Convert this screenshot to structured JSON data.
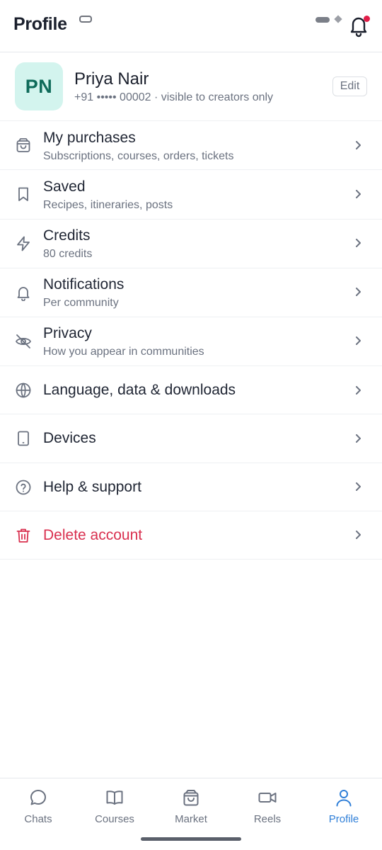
{
  "header": {
    "title": "Profile",
    "notifications_icon": "bell-icon",
    "has_unread": true,
    "unread_color": "#e11d48"
  },
  "profile": {
    "initials": "PN",
    "name": "Priya Nair",
    "phone_note": "+91 ••••• 00002 · visible to creators only",
    "edit_label": "Edit",
    "avatar_color": "#d3f4ee"
  },
  "menu": [
    {
      "title": "My purchases",
      "subtitle": "Subscriptions, courses, orders, tickets",
      "icon": "shopping-bag-icon"
    },
    {
      "title": "Saved",
      "subtitle": "Recipes, itineraries, posts",
      "icon": "bookmark-icon"
    },
    {
      "title": "Credits",
      "subtitle": "80 credits",
      "icon": "lightning-icon"
    },
    {
      "title": "Notifications",
      "subtitle": "Per community",
      "icon": "bell-icon"
    },
    {
      "title": "Privacy",
      "subtitle": "How you appear in communities",
      "icon": "eye-off-icon"
    },
    {
      "title": "Language, data & downloads",
      "icon": "globe-icon"
    },
    {
      "title": "Devices",
      "icon": "phone-icon"
    },
    {
      "title": "Help & support",
      "icon": "help-circle-icon"
    },
    {
      "title": "Delete account",
      "icon": "trash-icon",
      "danger_color": "#d9304f"
    }
  ],
  "tabs": [
    {
      "label": "Chats",
      "icon": "chat-bubble-icon"
    },
    {
      "label": "Courses",
      "icon": "book-icon"
    },
    {
      "label": "Market",
      "icon": "shopping-bag-icon"
    },
    {
      "label": "Reels",
      "icon": "video-icon"
    },
    {
      "label": "Profile",
      "icon": "user-icon",
      "active": true,
      "active_color": "#2f7fd8"
    }
  ]
}
